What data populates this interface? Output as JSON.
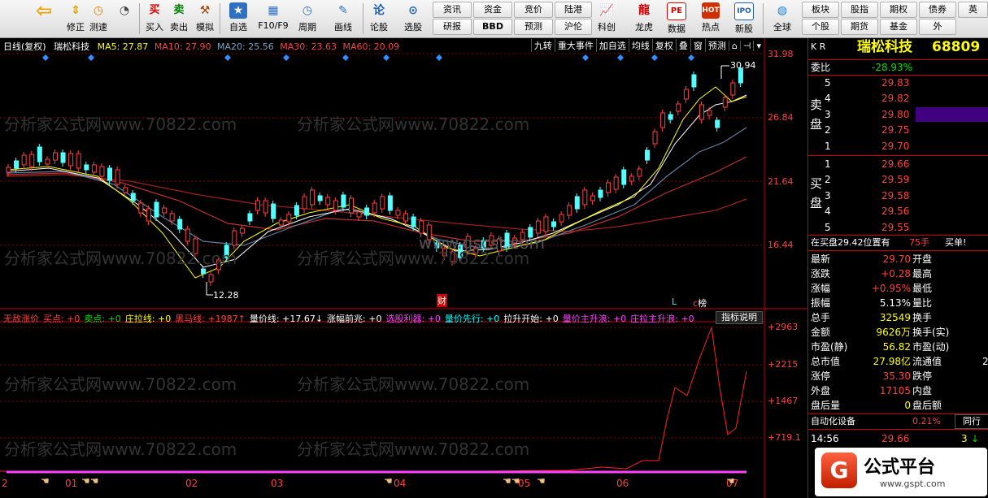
{
  "toolbar": {
    "buttons": [
      {
        "label": "",
        "icon": "back-arrow-icon"
      },
      {
        "label": "修正",
        "icon": "up-down-arrow-icon"
      },
      {
        "label": "测速",
        "icon": "lightning-icon"
      },
      {
        "label": "",
        "icon": "clock-icon"
      },
      {
        "label": "买入",
        "icon": "buy-icon",
        "text": "买"
      },
      {
        "label": "卖出",
        "icon": "sell-icon",
        "text": "卖"
      },
      {
        "label": "模拟",
        "icon": "hammer-icon"
      },
      {
        "label": "自选",
        "icon": "star-icon"
      },
      {
        "label": "F10/F9",
        "icon": "f10-icon"
      },
      {
        "label": "周期",
        "icon": "period-icon"
      },
      {
        "label": "画线",
        "icon": "pen-icon"
      },
      {
        "label": "论股",
        "icon": "discuss-icon"
      },
      {
        "label": "选股",
        "icon": "select-stock-icon"
      },
      {
        "label": "科创",
        "icon": "chart-icon"
      },
      {
        "label": "龙虎",
        "icon": "dragon-icon"
      },
      {
        "label": "数据",
        "icon": "pe-icon",
        "text": "PE"
      },
      {
        "label": "热点",
        "icon": "hot-icon"
      },
      {
        "label": "新股",
        "icon": "ipo-icon",
        "text": "IPO"
      },
      {
        "label": "全球",
        "icon": "globe-icon"
      }
    ],
    "quick_top": [
      "资讯",
      "资金",
      "竞价",
      "陆港"
    ],
    "quick_bottom": [
      "研报",
      "BBD",
      "预测",
      "沪伦"
    ],
    "right_top": [
      "板块",
      "股指",
      "期权",
      "债券",
      "英"
    ],
    "right_bottom": [
      "个股",
      "期货",
      "基金",
      "外"
    ]
  },
  "chart_header": {
    "title": "日线(复权)",
    "stock": "瑞松科技",
    "ma5": "MA5: 27.87",
    "ma10": "MA10: 27.90",
    "ma20": "MA20: 25.56",
    "ma30": "MA30: 23.63",
    "ma60": "MA60: 20.09",
    "right_tools": [
      "九转",
      "重大事件",
      "加自选",
      "均线",
      "复权",
      "叠",
      "窗",
      "预测"
    ]
  },
  "price_axis": [
    "31.98",
    "26.84",
    "21.64",
    "16.44"
  ],
  "annotations": {
    "high": "30.94",
    "low": "12.28",
    "cai": "财",
    "l": "L",
    "bang": "榜"
  },
  "indicator_header": [
    {
      "text": "无敌涨价",
      "color": "#ff4040"
    },
    {
      "text": "买点: +0",
      "color": "#ff4040"
    },
    {
      "text": "卖点: +0",
      "color": "#00e000"
    },
    {
      "text": "庄拉线: +0",
      "color": "#ffff00"
    },
    {
      "text": "黑马线: +1987↑",
      "color": "#ff4040"
    },
    {
      "text": "量价线: +17.67↓",
      "color": "#ffffff"
    },
    {
      "text": "涨幅前兆: +0",
      "color": "#ffffff"
    },
    {
      "text": "选股利器: +0",
      "color": "#ff40ff"
    },
    {
      "text": "量价先行: +0",
      "color": "#00ffff"
    },
    {
      "text": "拉升开始: +0",
      "color": "#ffffff"
    },
    {
      "text": "量价主升浪: +0",
      "color": "#ff40ff"
    },
    {
      "text": "庄拉主升浪: +0",
      "color": "#ff40ff"
    }
  ],
  "indicator_button": "指标说明",
  "indicator_axis": [
    "+2963",
    "+2215",
    "+1467",
    "+719.1"
  ],
  "x_axis": [
    "2",
    "01",
    "02",
    "03",
    "04",
    "05",
    "06",
    "07"
  ],
  "watermark": "分析家公式网www.70822.com",
  "watermark2": "www.gscst.com",
  "right_panel": {
    "code_prefix": "K R",
    "name": "瑞松科技",
    "code": "68809",
    "weibi_label": "委比",
    "weibi": "-28.93%",
    "sell_label": "卖盘",
    "buy_label": "买盘",
    "sells": [
      {
        "n": "5",
        "p": "29.83"
      },
      {
        "n": "4",
        "p": "29.82"
      },
      {
        "n": "3",
        "p": "29.80"
      },
      {
        "n": "2",
        "p": "29.75"
      },
      {
        "n": "1",
        "p": "29.70"
      }
    ],
    "buys": [
      {
        "n": "1",
        "p": "29.66"
      },
      {
        "n": "2",
        "p": "29.59"
      },
      {
        "n": "3",
        "p": "29.58"
      },
      {
        "n": "4",
        "p": "29.56"
      },
      {
        "n": "5",
        "p": "29.55"
      }
    ],
    "position_note": "在买盘29.42位置有",
    "position_qty": "75手",
    "position_btn": "买单!",
    "stats": [
      {
        "k": "最新",
        "v": "29.70",
        "k2": "开盘",
        "c": "#ff4040"
      },
      {
        "k": "涨跌",
        "v": "+0.28",
        "k2": "最高",
        "c": "#ff4040"
      },
      {
        "k": "涨幅",
        "v": "+0.95%",
        "k2": "最低",
        "c": "#ff4040"
      },
      {
        "k": "振幅",
        "v": "5.13%",
        "k2": "量比",
        "c": "#ffffff"
      },
      {
        "k": "总手",
        "v": "32549",
        "k2": "换手",
        "c": "#ffff00"
      },
      {
        "k": "金额",
        "v": "9626万",
        "k2": "换手(实)",
        "c": "#ffff00"
      },
      {
        "k": "市盈(静)",
        "v": "56.82",
        "k2": "市盈(动)",
        "c": "#ffff00"
      },
      {
        "k": "总市值",
        "v": "27.98亿",
        "k2": "流通值",
        "c": "#ffff00"
      },
      {
        "k": "涨停",
        "v": "35.30",
        "k2": "跌停",
        "c": "#ff4040"
      },
      {
        "k": "外盘",
        "v": "17105",
        "k2": "内盘",
        "c": "#ff4040"
      },
      {
        "k": "盘后量",
        "v": "0",
        "k2": "盘后额",
        "c": "#ffff00"
      }
    ],
    "flow_right": "2",
    "sector": "自动化设备",
    "sector_pct": "0.21%",
    "sector_btn": "同行",
    "tick_time": "14:56",
    "tick_price": "29.66",
    "tick_vol": "3"
  },
  "logo": {
    "text": "公式平台",
    "url_text": "www.gspt.com"
  }
}
